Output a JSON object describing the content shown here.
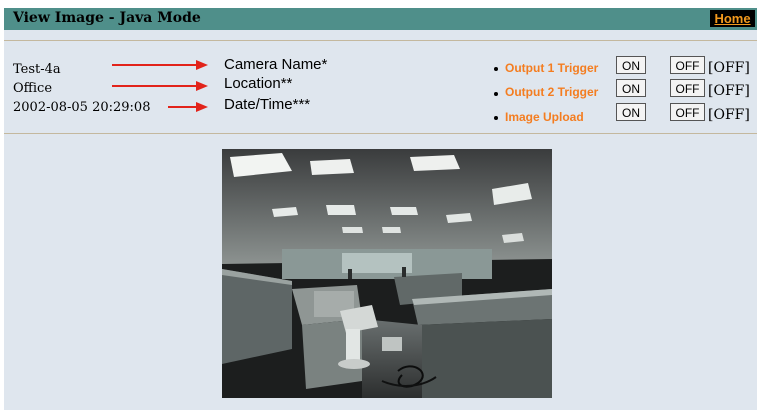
{
  "header": {
    "title": "View Image - Java Mode",
    "home_label": "Home"
  },
  "camera_info": {
    "name": "Test-4a",
    "location": "Office",
    "datetime": "2002-08-05 20:29:08"
  },
  "legend": {
    "name_label": "Camera Name*",
    "location_label": "Location**",
    "datetime_label": "Date/Time***"
  },
  "triggers": [
    {
      "label": "Output 1 Trigger",
      "on_label": "ON",
      "off_label": "OFF",
      "state": "[OFF]"
    },
    {
      "label": "Output 2 Trigger",
      "on_label": "ON",
      "off_label": "OFF",
      "state": "[OFF]"
    },
    {
      "label": "Image Upload",
      "on_label": "ON",
      "off_label": "OFF",
      "state": "[OFF]"
    }
  ],
  "colors": {
    "header_bg": "#4f8f8a",
    "page_bg": "#dfe6ee",
    "accent_orange": "#f47d20",
    "arrow_red": "#e2231a"
  },
  "image": {
    "description_icon": "camera-image"
  }
}
